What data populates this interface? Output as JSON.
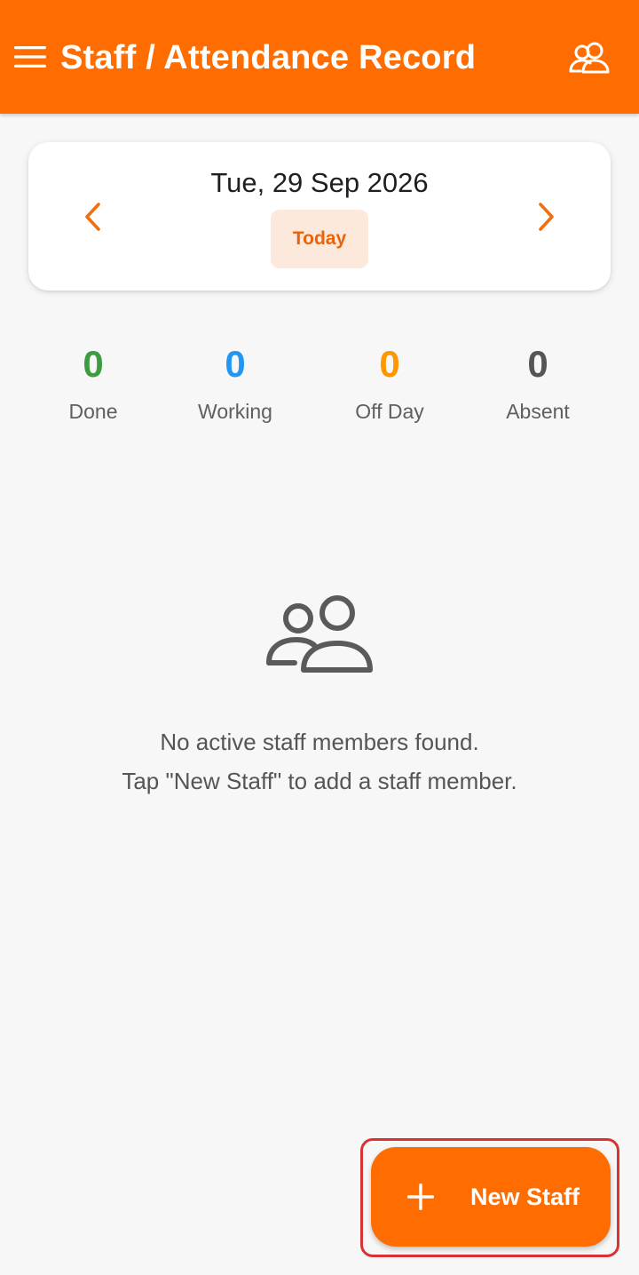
{
  "app_bar": {
    "title": "Staff / Attendance Record",
    "background": "#ff6d00",
    "menu_icon": "hamburger-menu-icon",
    "action_icon": "people-icon"
  },
  "date_card": {
    "date": "Tue, 29 Sep 2026",
    "today_label": "Today",
    "prev_icon": "chevron-left-icon",
    "next_icon": "chevron-right-icon",
    "accent": "#f07010"
  },
  "stats": [
    {
      "value": "0",
      "label": "Done",
      "color": "#3f9b3f"
    },
    {
      "value": "0",
      "label": "Working",
      "color": "#2196f3"
    },
    {
      "value": "0",
      "label": "Off Day",
      "color": "#ff9800"
    },
    {
      "value": "0",
      "label": "Absent",
      "color": "#555555"
    }
  ],
  "empty_state": {
    "icon": "people-icon",
    "line1": "No active staff members found.",
    "line2": "Tap \"New Staff\" to add a staff member."
  },
  "fab": {
    "label": "New Staff",
    "icon": "plus-icon"
  }
}
